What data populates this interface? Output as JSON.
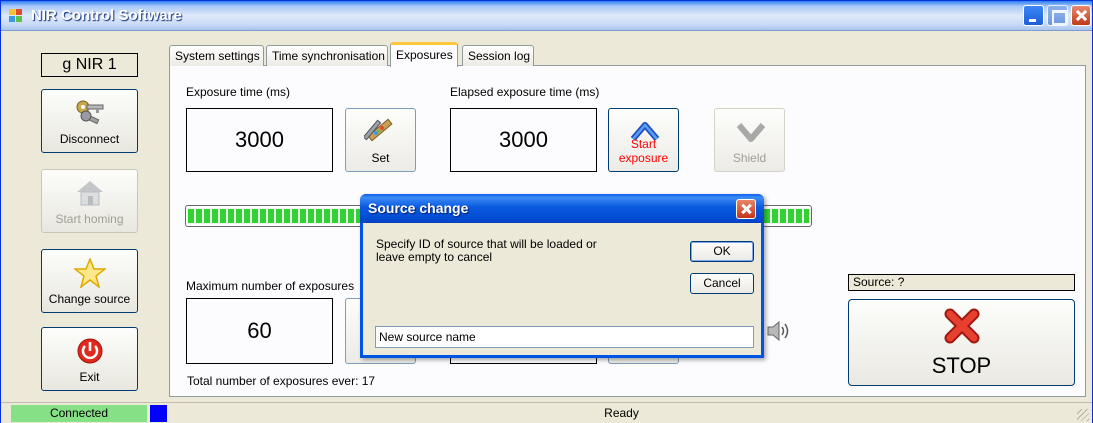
{
  "window": {
    "title": "NIR Control Software"
  },
  "sidebar": {
    "device_label": "g NIR 1",
    "buttons": [
      {
        "label": "Disconnect",
        "icon": "keys-icon",
        "enabled": true
      },
      {
        "label": "Start homing",
        "icon": "house-icon",
        "enabled": false
      },
      {
        "label": "Change source",
        "icon": "star-icon",
        "enabled": true
      },
      {
        "label": "Exit",
        "icon": "power-icon",
        "enabled": true
      }
    ]
  },
  "tabs": [
    {
      "label": "System settings",
      "active": false
    },
    {
      "label": "Time synchronisation",
      "active": false
    },
    {
      "label": "Exposures",
      "active": true
    },
    {
      "label": "Session log",
      "active": false
    }
  ],
  "exposures": {
    "exposure_time_label": "Exposure time (ms)",
    "exposure_time_value": "3000",
    "set_label": "Set",
    "elapsed_label": "Elapsed exposure time (ms)",
    "elapsed_value": "3000",
    "start_exposure_label": "Start exposure",
    "shield_label": "Shield",
    "progress": 1.0,
    "max_exposures_label": "Maximum number of exposures",
    "max_exposures_value": "60",
    "total_exposures_text": "Total number of exposures ever: 17",
    "source_text": "Source: ?",
    "stop_label": "STOP"
  },
  "dialog": {
    "title": "Source change",
    "message": "Specify ID of source that will be loaded or leave empty to cancel",
    "ok_label": "OK",
    "cancel_label": "Cancel",
    "input_value": "New source name"
  },
  "statusbar": {
    "connection": "Connected",
    "status": "Ready"
  },
  "colors": {
    "accent": "#0054e3",
    "start_exposure_text": "#ff0000",
    "connected_bg": "#86e086",
    "indicator": "#0000ff",
    "progress": "#2ed52e"
  }
}
